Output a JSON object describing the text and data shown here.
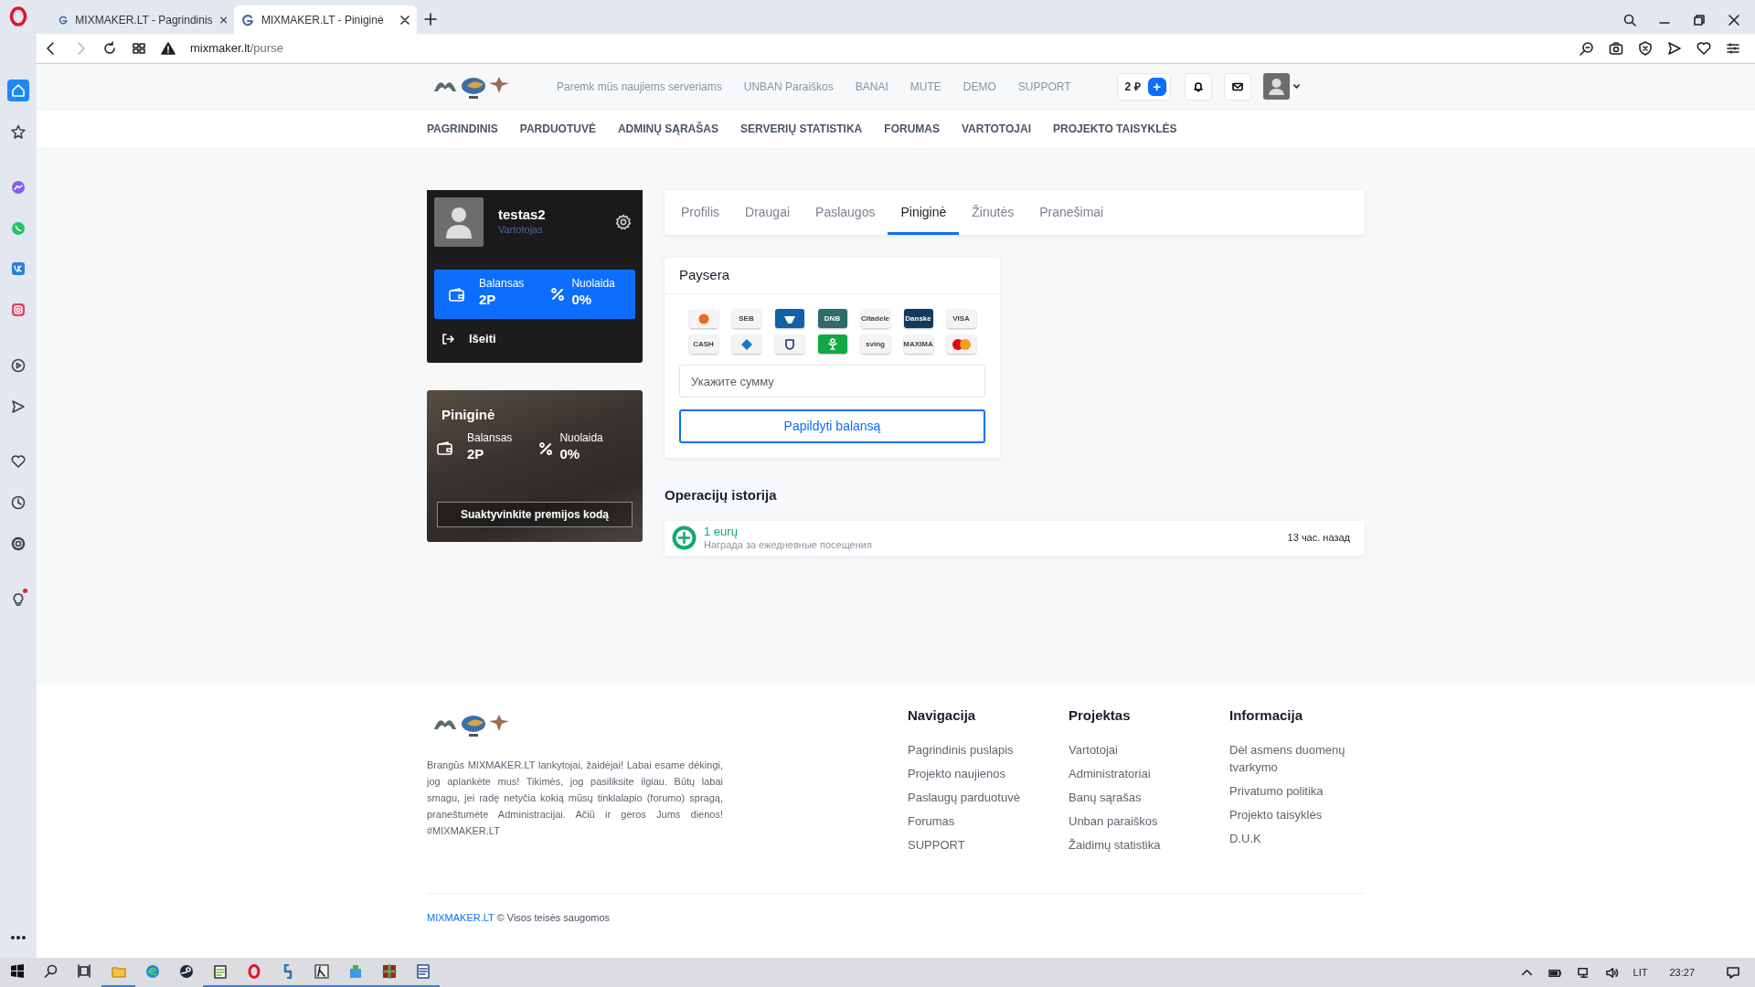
{
  "browser": {
    "tabs": [
      {
        "title": "MIXMAKER.LT - Pagrindinis",
        "selected": false
      },
      {
        "title": "MIXMAKER.LT - Piniginė",
        "selected": true
      }
    ],
    "url": {
      "host": "mixmaker.lt",
      "path": "/purse"
    }
  },
  "sidebar": {
    "items": [
      {
        "selected": true,
        "badge": false
      },
      {
        "selected": false,
        "badge": false
      },
      {
        "selected": false,
        "badge": false
      },
      {
        "selected": false,
        "badge": false
      },
      {
        "selected": false,
        "badge": false
      },
      {
        "selected": false,
        "badge": false
      },
      {
        "selected": false,
        "badge": false
      },
      {
        "selected": false,
        "badge": false
      },
      {
        "selected": false,
        "badge": false
      },
      {
        "selected": false,
        "badge": false
      },
      {
        "selected": false,
        "badge": false
      },
      {
        "selected": false,
        "badge": true
      }
    ]
  },
  "header": {
    "links": [
      "Paremk mūs naujiems serveriams",
      "UNBAN Paraiškos",
      "BANAI",
      "MUTE",
      "DEMO",
      "SUPPORT"
    ],
    "balance": "2 ₽",
    "add_button": "+"
  },
  "nav": [
    "PAGRINDINIS",
    "PARDUOTUVĖ",
    "ADMINŲ SĄRAŠAS",
    "SERVERIŲ STATISTIKA",
    "FORUMAS",
    "VARTOTOJAI",
    "PROJEKTO TAISYKLĖS"
  ],
  "profile": {
    "username": "testas2",
    "role": "Vartotojas",
    "balance_label": "Balansas",
    "balance_value": "2P",
    "discount_label": "Nuolaida",
    "discount_value": "0%",
    "logout": "Išeiti"
  },
  "wallet": {
    "title": "Piniginė",
    "balance_label": "Balansas",
    "balance_value": "2P",
    "discount_label": "Nuolaida",
    "discount_value": "0%",
    "button": "Suaktyvinkite premijos kodą"
  },
  "tabs": [
    {
      "label": "Profilis",
      "selected": false
    },
    {
      "label": "Draugai",
      "selected": false
    },
    {
      "label": "Paslaugos",
      "selected": false
    },
    {
      "label": "Piniginė",
      "selected": true
    },
    {
      "label": "Žinutės",
      "selected": false
    },
    {
      "label": "Pranešimai",
      "selected": false
    }
  ],
  "payment": {
    "title": "Paysera",
    "methods": [
      {
        "kind": "circle",
        "color": "#f4f4f4"
      },
      {
        "kind": "text",
        "label": "SEB",
        "color": "#f4f4f4"
      },
      {
        "kind": "shape",
        "color": "#1160a8"
      },
      {
        "kind": "text",
        "label": "DNB",
        "color": "#2f6b67"
      },
      {
        "kind": "text",
        "label": "Citadele",
        "color": "#f4f4f4"
      },
      {
        "kind": "text",
        "label": "Danske",
        "color": "#113a5c"
      },
      {
        "kind": "text",
        "label": "VISA",
        "color": "#f4f4f4"
      },
      {
        "kind": "text",
        "label": "CASH",
        "color": "#f4f4f4"
      },
      {
        "kind": "diamond",
        "color": "#f4f4f4"
      },
      {
        "kind": "crest",
        "color": "#f4f4f4"
      },
      {
        "kind": "figure",
        "color": "#12a845"
      },
      {
        "kind": "text",
        "label": "sving",
        "color": "#f4f4f4"
      },
      {
        "kind": "text",
        "label": "MAXIMA",
        "color": "#f4f4f4"
      },
      {
        "kind": "cards",
        "color": "#f4f4f4"
      }
    ],
    "placeholder": "Укажите сумму",
    "button": "Papildyti balansą"
  },
  "history": {
    "title": "Operacijų istorija",
    "entries": [
      {
        "amount": "1 eurų",
        "description": "Награда за ежедневные посещения",
        "time": "13 час. назад"
      }
    ]
  },
  "footer": {
    "text": "Brangūs MIXMAKER.LT lankytojai, žaidėjai! Labai esame dėkingi, jog aplankėte mus! Tikimės, jog pasiliksite ilgiau. Būtų labai smagu, jei radę netyčia kokią mūsų tinklalapio (forumo) spragą, praneštumėte Administracijai. Ačiū ir geros Jums dienos! #MIXMAKER.LT",
    "columns": [
      {
        "title": "Navigacija",
        "links": [
          "Pagrindinis puslapis",
          "Projekto naujienos",
          "Paslaugų parduotuvė",
          "Forumas",
          "SUPPORT"
        ]
      },
      {
        "title": "Projektas",
        "links": [
          "Vartotojai",
          "Administratoriai",
          "Banų sąrašas",
          "Unban paraiškos",
          "Žaidimų statistika"
        ]
      },
      {
        "title": "Informacija",
        "links": [
          "Dėl asmens duomenų tvarkymo",
          "Privatumo politika",
          "Projekto taisyklės",
          "D.U.K"
        ]
      }
    ],
    "copyright_link": "MIXMAKER.LT",
    "copyright_text": "© Visos teisės saugomos"
  },
  "taskbar": {
    "apps": [
      {
        "running": false
      },
      {
        "running": false
      },
      {
        "running": false
      },
      {
        "running": true
      },
      {
        "running": false
      },
      {
        "running": false
      },
      {
        "running": true
      },
      {
        "running": true
      },
      {
        "running": true
      },
      {
        "running": true
      },
      {
        "running": true
      },
      {
        "running": true
      },
      {
        "running": true
      }
    ],
    "language": "LIT",
    "time": "23:27"
  }
}
